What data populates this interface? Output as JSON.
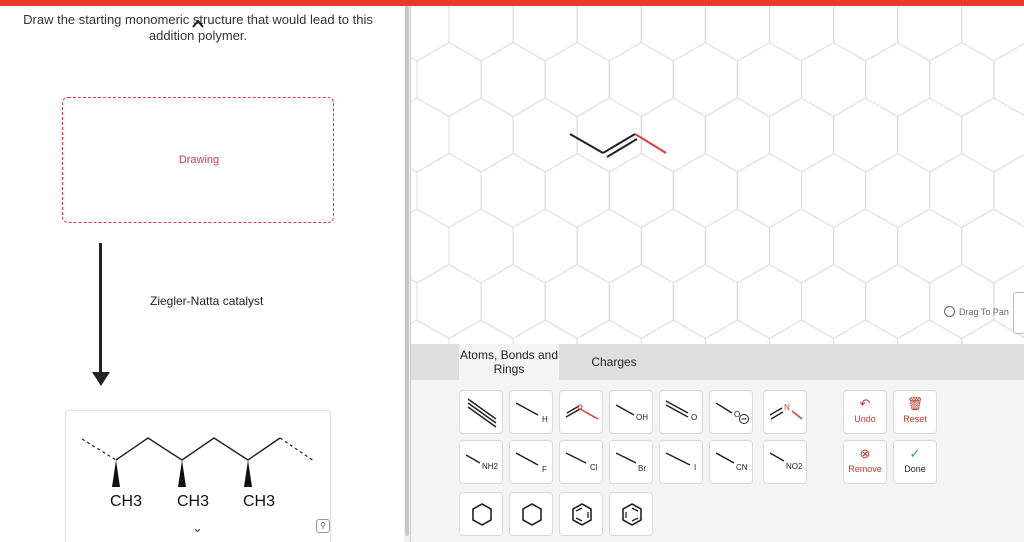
{
  "question": {
    "prompt": "Draw the starting monomeric structure that would lead to this addition polymer.",
    "drawing_label": "Drawing",
    "catalyst": "Ziegler-Natta catalyst",
    "polymer_substituents": [
      "CH3",
      "CH3",
      "CH3"
    ]
  },
  "canvas": {
    "drag_to_pan": "Drag To Pan"
  },
  "toolbar": {
    "tabs": [
      {
        "label": "Atoms, Bonds and Rings",
        "active": true
      },
      {
        "label": "Charges",
        "active": false
      }
    ],
    "tools_row1": [
      {
        "name": "triple-bond",
        "label": ""
      },
      {
        "name": "aldehyde-h",
        "label": "H"
      },
      {
        "name": "ketone-o",
        "label": ""
      },
      {
        "name": "hydroxyl",
        "label": "OH"
      },
      {
        "name": "carbonyl-o",
        "label": "O"
      },
      {
        "name": "oxide-anion",
        "label": "O"
      },
      {
        "name": "imine-n",
        "label": "N"
      }
    ],
    "tools_row2": [
      {
        "name": "amine",
        "label": "NH2"
      },
      {
        "name": "fluoro",
        "label": "F"
      },
      {
        "name": "chloro",
        "label": "Cl"
      },
      {
        "name": "bromo",
        "label": "Br"
      },
      {
        "name": "iodo",
        "label": "I"
      },
      {
        "name": "nitrile",
        "label": "CN"
      },
      {
        "name": "nitro",
        "label": "NO2"
      }
    ],
    "tools_row3": [
      "cyclohexane",
      "cyclohexene",
      "benzene",
      "benzene-alt"
    ],
    "actions": {
      "undo": "Undo",
      "reset": "Reset",
      "remove": "Remove",
      "done": "Done"
    }
  },
  "colors": {
    "accent": "#e8392c",
    "grid": "#dcdcdc",
    "remove": "#c0392b",
    "done": "#27ae60"
  }
}
